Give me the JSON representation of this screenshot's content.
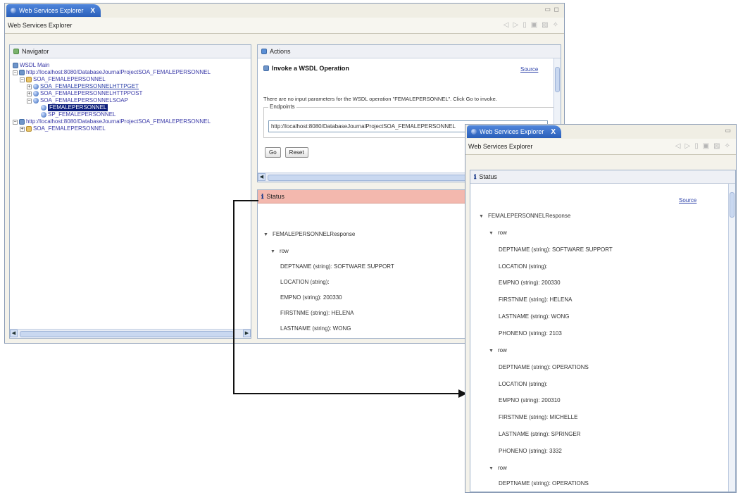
{
  "win1": {
    "tab_label": "Web Services Explorer",
    "tab_close": "X",
    "window_controls": "▭ ◻",
    "title": "Web Services Explorer",
    "navigator": {
      "title": "Navigator",
      "tree": [
        {
          "label": "WSDL Main"
        },
        {
          "label": "http://localhost:8080/DatabaseJournalProjectSOA_FEMALEPERSONNEL"
        },
        {
          "label": "SOA_FEMALEPERSONNEL"
        },
        {
          "label": "SOA_FEMALEPERSONNELHTTPGET"
        },
        {
          "label": "SOA_FEMALEPERSONNELHTTPPOST"
        },
        {
          "label": "SOA_FEMALEPERSONNELSOAP"
        },
        {
          "label": "FEMALEPERSONNEL"
        },
        {
          "label": "SP_FEMALEPERSONNEL"
        },
        {
          "label": "http://localhost:8080/DatabaseJournalProjectSOA_FEMALEPERSONNEL"
        },
        {
          "label": "SOA_FEMALEPERSONNEL"
        }
      ]
    },
    "actions": {
      "title": "Actions",
      "heading": "Invoke a WSDL Operation",
      "source_link": "Source",
      "message": "There are no input parameters for the WSDL operation \"FEMALEPERSONNEL\". Click Go to invoke.",
      "endpoints_label": "Endpoints",
      "endpoint_value": "http://localhost:8080/DatabaseJournalProjectSOA_FEMALEPERSONNEL",
      "go_button": "Go",
      "reset_button": "Reset"
    },
    "status": {
      "title": "Status",
      "response": "FEMALEPERSONNELResponse",
      "row_label": "row",
      "fields": [
        "DEPTNAME (string): SOFTWARE SUPPORT",
        "LOCATION (string):",
        "EMPNO (string): 200330",
        "FIRSTNME (string): HELENA",
        "LASTNAME (string): WONG"
      ]
    }
  },
  "win2": {
    "tab_label": "Web Services Explorer",
    "tab_close": "X",
    "window_controls": "▭",
    "title": "Web Services Explorer",
    "status": {
      "title": "Status",
      "source_link": "Source",
      "response": "FEMALEPERSONNELResponse",
      "rows": [
        {
          "label": "row",
          "fields": [
            "DEPTNAME (string): SOFTWARE SUPPORT",
            "LOCATION (string):",
            "EMPNO (string): 200330",
            "FIRSTNME (string): HELENA",
            "LASTNAME (string): WONG",
            "PHONENO (string): 2103"
          ]
        },
        {
          "label": "row",
          "fields": [
            "DEPTNAME (string): OPERATIONS",
            "LOCATION (string):",
            "EMPNO (string): 200310",
            "FIRSTNME (string): MICHELLE",
            "LASTNAME (string): SPRINGER",
            "PHONENO (string): 3332"
          ]
        },
        {
          "label": "row",
          "fields": [
            "DEPTNAME (string): OPERATIONS"
          ]
        }
      ]
    }
  },
  "colors": {
    "tab_blue": "#2a5fb9",
    "status_header": "#f3b8ae",
    "selection": "#0b1d7a",
    "link": "#2a3fa8"
  }
}
